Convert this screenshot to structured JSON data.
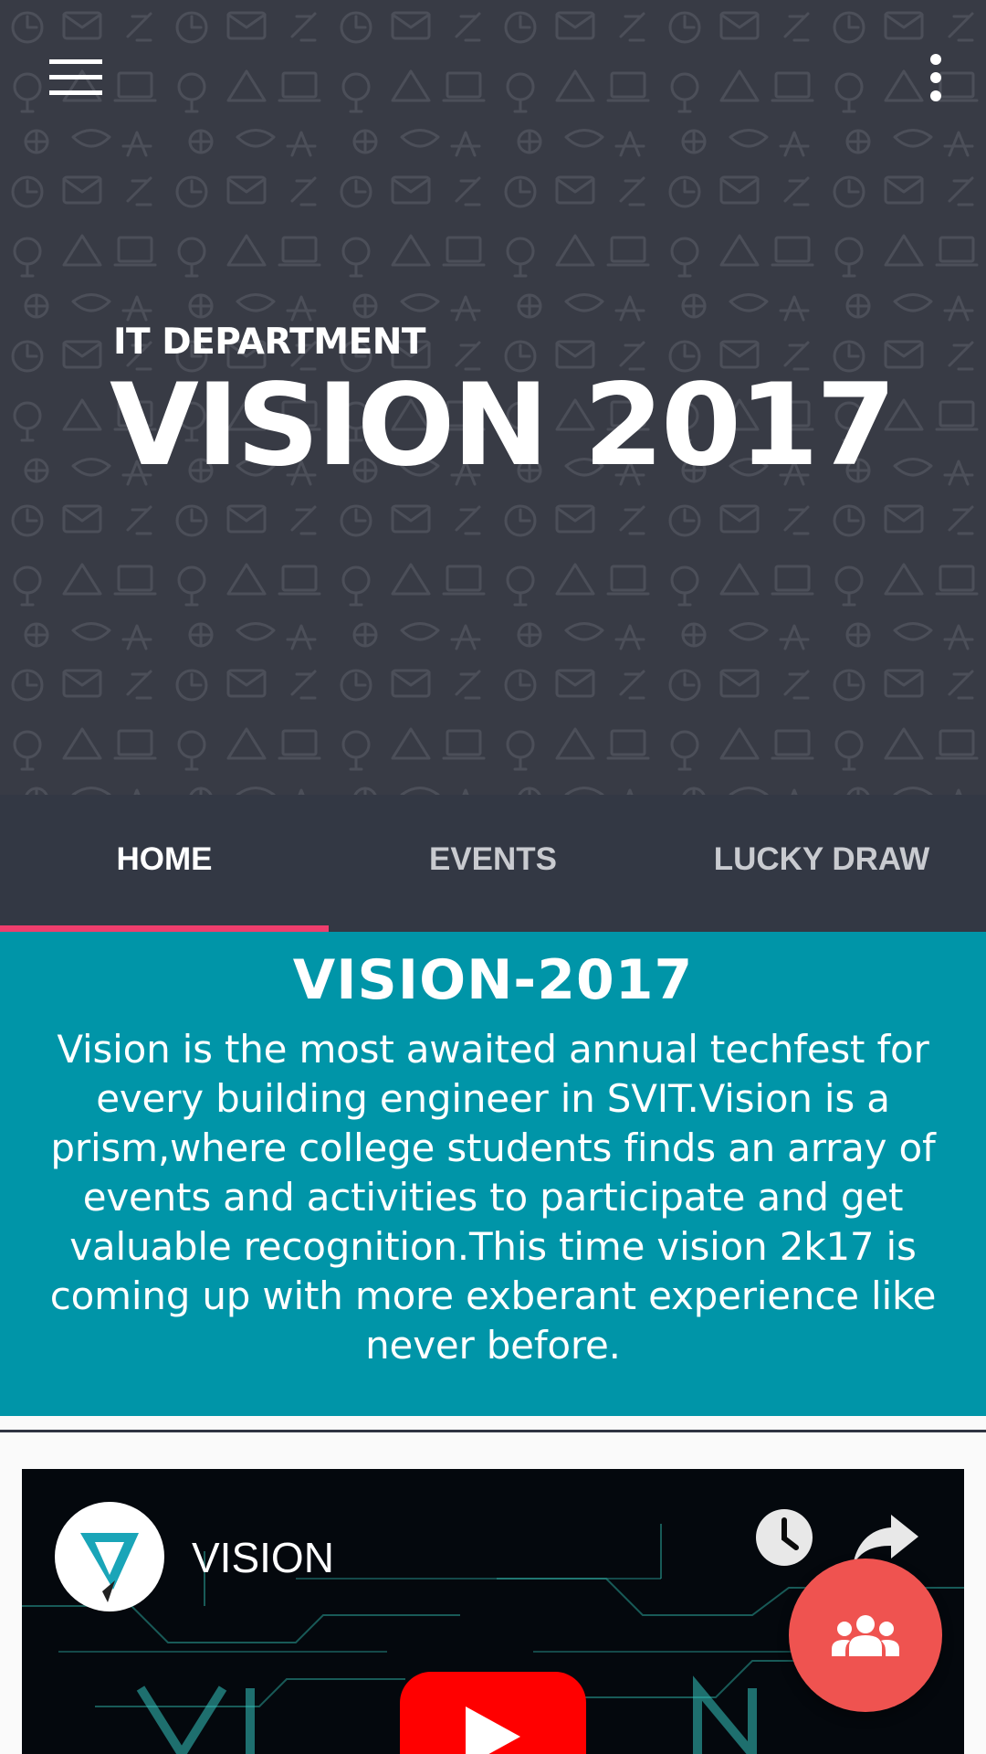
{
  "header": {
    "department": "IT DEPARTMENT",
    "event_title": "VISION 2017",
    "menu_icon": "hamburger-menu-icon",
    "overflow_icon": "more-vertical-icon"
  },
  "tabs": [
    {
      "label": "HOME",
      "active": true
    },
    {
      "label": "EVENTS",
      "active": false
    },
    {
      "label": "LUCKY DRAW",
      "active": false
    }
  ],
  "intro": {
    "title": "VISION-2017",
    "text": "Vision is the most awaited annual techfest for every building engineer in SVIT.Vision is a prism,where college students finds an array of events and activities to participate and get valuable recognition.This time vision 2k17 is coming up with more exberant experience like never before."
  },
  "video": {
    "channel_name": "VISION",
    "watch_later_icon": "clock-icon",
    "share_icon": "share-arrow-icon",
    "play_icon": "youtube-play-icon"
  },
  "fab": {
    "icon": "group-icon"
  },
  "colors": {
    "header_bg": "#383b45",
    "tab_bar_bg": "#333844",
    "tab_indicator": "#ef3e6d",
    "info_bg": "#0095a8",
    "fab_bg": "#ef5350",
    "play_button": "#ff0000"
  }
}
